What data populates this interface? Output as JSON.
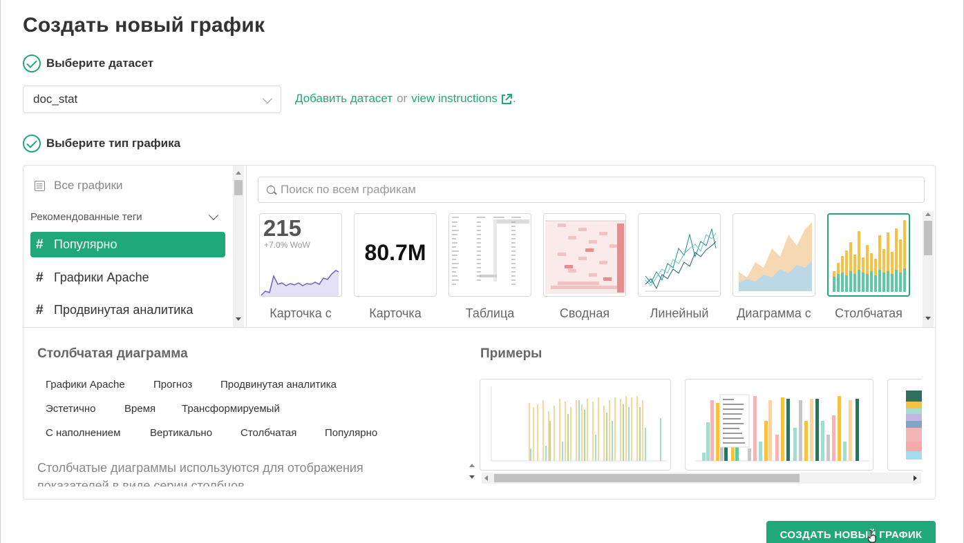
{
  "page": {
    "title": "Создать новый график"
  },
  "steps": {
    "dataset_label": "Выберите датасет",
    "chart_type_label": "Выберите тип графика"
  },
  "dataset": {
    "selected": "doc_stat",
    "add_link": "Добавить датасет",
    "or": "or",
    "instructions_link": "view instructions",
    "period": "."
  },
  "sidebar": {
    "all_charts": "Все графики",
    "recommended_tags": "Рекомендованные теги",
    "items": [
      {
        "label": "Популярно",
        "active": true
      },
      {
        "label": "Графики Apache",
        "active": false
      },
      {
        "label": "Продвинутая аналитика",
        "active": false
      }
    ]
  },
  "search": {
    "placeholder": "Поиск по всем графикам"
  },
  "gallery": {
    "thumbnails": [
      {
        "label": "Карточка с",
        "big_number": "215",
        "sub": "+7.0% WoW"
      },
      {
        "label": "Карточка",
        "big_number": "80.7M"
      },
      {
        "label": "Таблица"
      },
      {
        "label": "Сводная"
      },
      {
        "label": "Линейный"
      },
      {
        "label": "Диаграмма с"
      },
      {
        "label": "Столбчатая",
        "selected": true
      }
    ]
  },
  "details": {
    "title": "Столбчатая диаграмма",
    "tags": [
      "Графики Apache",
      "Прогноз",
      "Продвинутая аналитика",
      "Эстетично",
      "Время",
      "Трансформируемый",
      "С наполнением",
      "Вертикально",
      "Столбчатая",
      "Популярно"
    ],
    "description": "Столбчатые диаграммы используются для отображения показателей в виде серии столбцов.",
    "examples_title": "Примеры"
  },
  "footer": {
    "create_button": "СОЗДАТЬ НОВЫЙ ГРАФИК"
  },
  "colors": {
    "accent": "#20a77a"
  }
}
